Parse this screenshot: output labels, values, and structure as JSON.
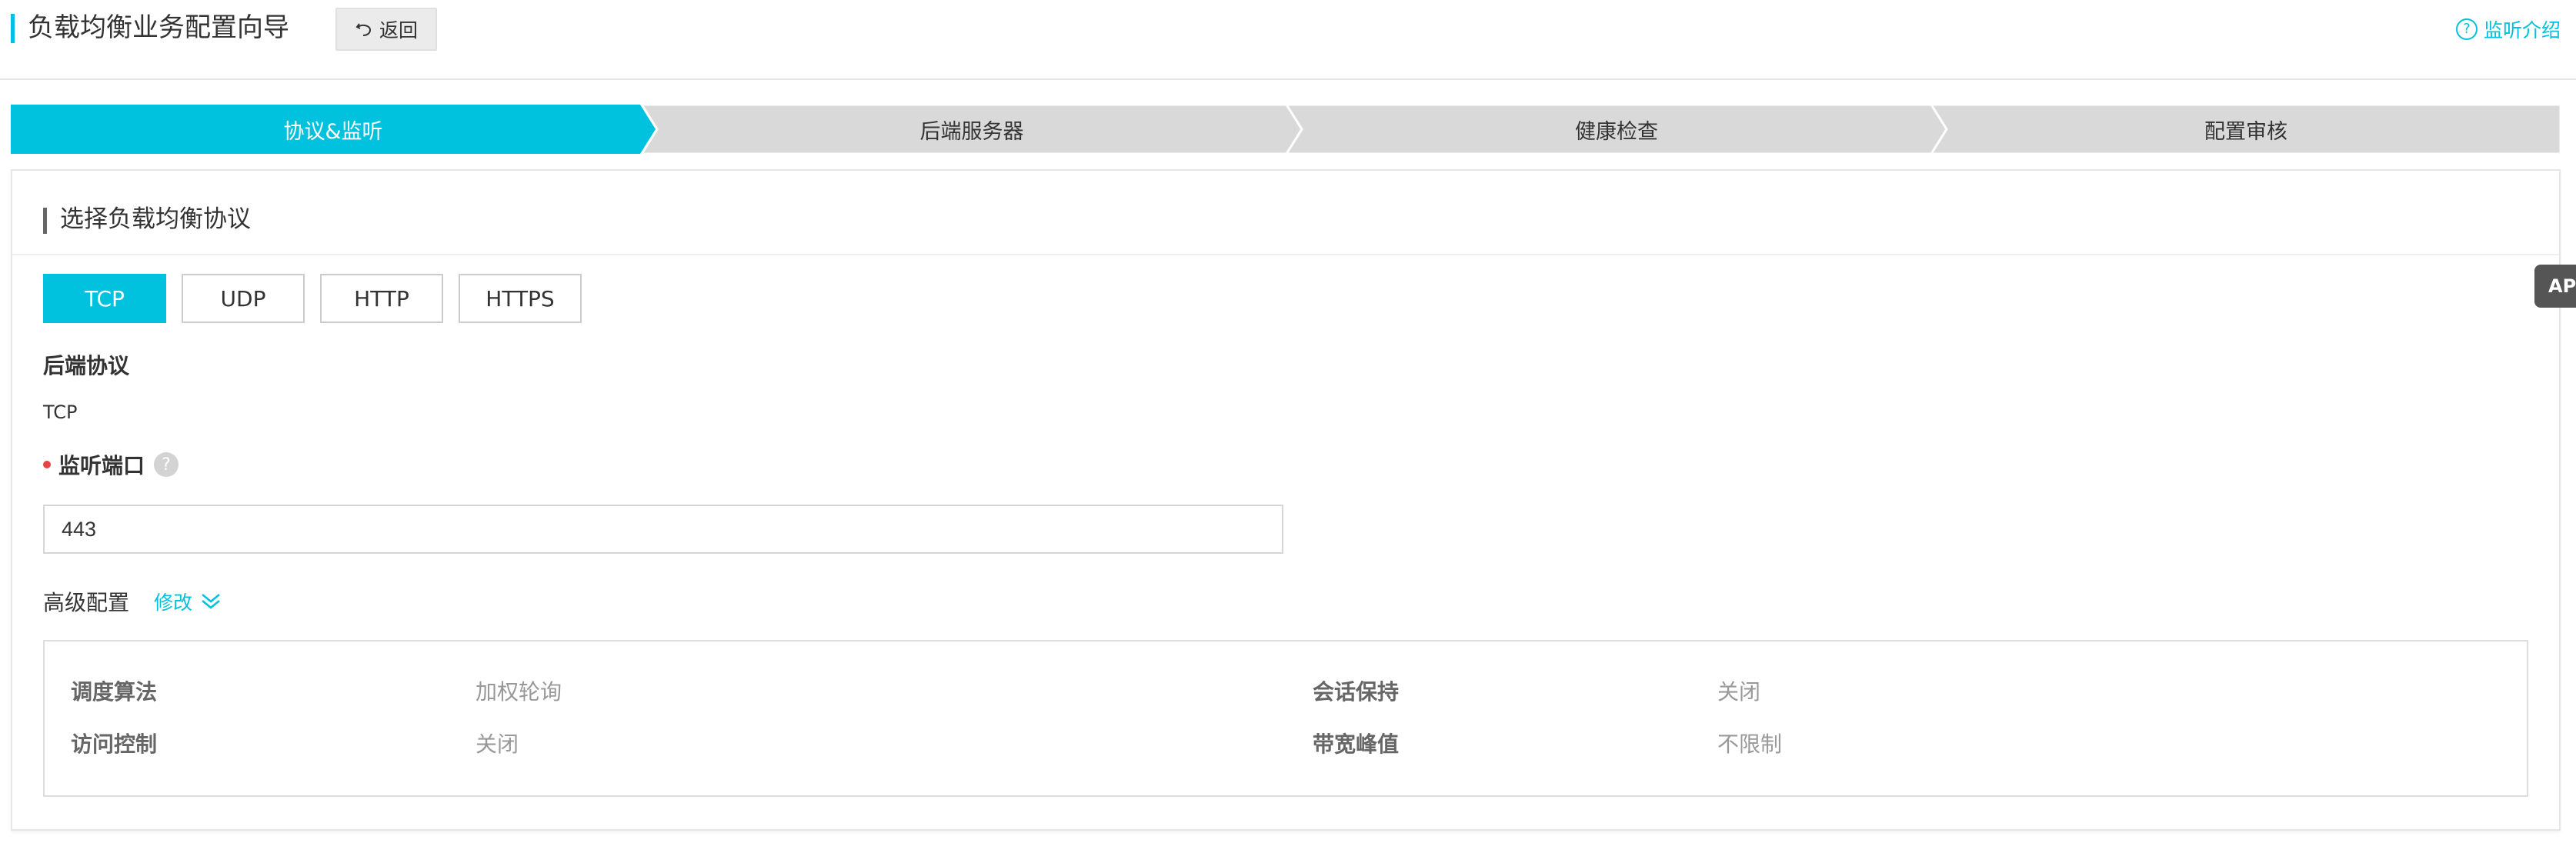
{
  "header": {
    "title": "负载均衡业务配置向导",
    "back_label": "返回",
    "help_label": "监听介绍",
    "help_icon_glyph": "?"
  },
  "steps": [
    {
      "label": "协议&监听",
      "active": true
    },
    {
      "label": "后端服务器",
      "active": false
    },
    {
      "label": "健康检查",
      "active": false
    },
    {
      "label": "配置审核",
      "active": false
    }
  ],
  "section": {
    "title": "选择负载均衡协议"
  },
  "protocols": {
    "options": [
      "TCP",
      "UDP",
      "HTTP",
      "HTTPS"
    ],
    "selected": "TCP"
  },
  "backend_protocol": {
    "label": "后端协议",
    "value": "TCP"
  },
  "listen_port": {
    "label": "监听端口",
    "help_glyph": "?",
    "value": "443"
  },
  "advanced": {
    "title": "高级配置",
    "modify_label": "修改",
    "rows": [
      {
        "label1": "调度算法",
        "value1": "加权轮询",
        "label2": "会话保持",
        "value2": "关闭"
      },
      {
        "label1": "访问控制",
        "value1": "关闭",
        "label2": "带宽峰值",
        "value2": "不限制"
      }
    ]
  },
  "api_tab": {
    "label": "API"
  },
  "colors": {
    "accent": "#00c1de",
    "step_inactive": "#d9d9d9",
    "required": "#e64545"
  }
}
